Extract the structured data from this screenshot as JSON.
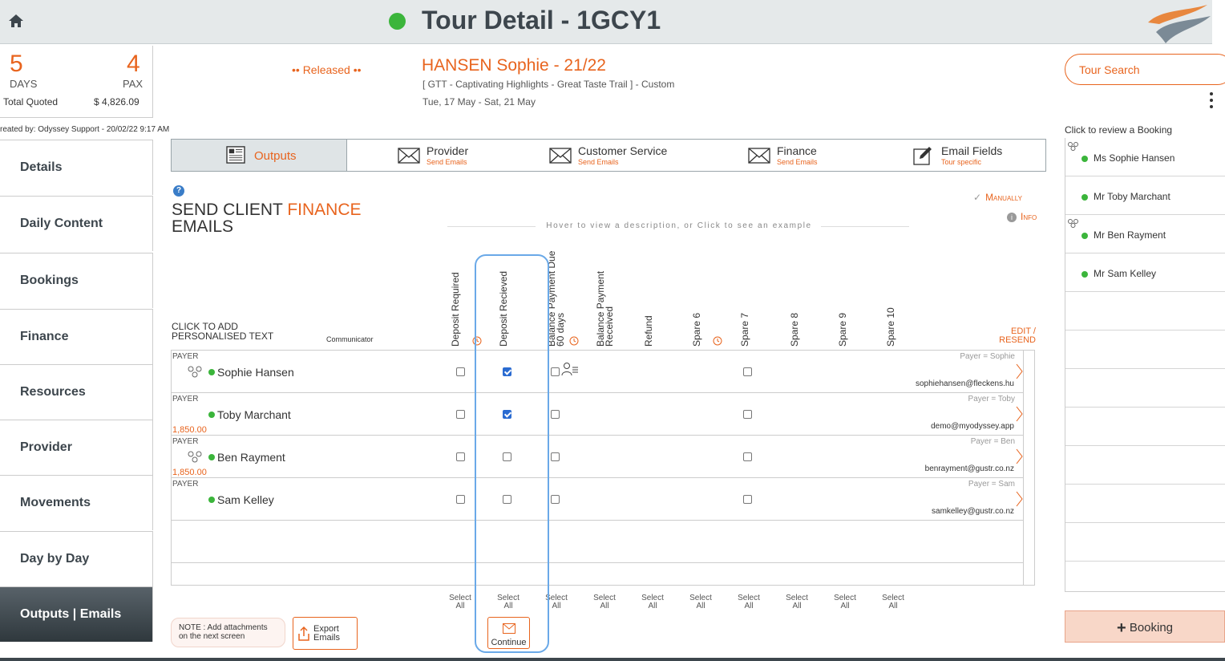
{
  "header": {
    "title": "Tour Detail - 1GCY1",
    "status_color": "#3bb53b"
  },
  "summary": {
    "days_value": "5",
    "days_label": "DAYS",
    "pax_value": "4",
    "pax_label": "PAX",
    "total_quoted_label": "Total Quoted",
    "total_quoted_value": "$ 4,826.09",
    "created_by": "reated by: Odyssey Support - 20/02/22 9:17 AM"
  },
  "tour": {
    "status": "•• Released ••",
    "client": "HANSEN Sophie - 21/22",
    "description": "[ GTT - Captivating Highlights - Great Taste Trail ] - Custom",
    "dates": "Tue, 17 May  - Sat, 21 May"
  },
  "right_panel": {
    "search_label": "Tour Search",
    "review_label": "Click to review a Booking",
    "bookings": [
      {
        "name": "Ms Sophie Hansen",
        "group_icon": true
      },
      {
        "name": "Mr Toby Marchant",
        "group_icon": false
      },
      {
        "name": "Mr Ben Rayment",
        "group_icon": true
      },
      {
        "name": "Mr Sam Kelley",
        "group_icon": false
      }
    ],
    "add_booking_label": "Booking"
  },
  "nav": {
    "items": [
      "Details",
      "Daily Content",
      "Bookings",
      "Finance",
      "Resources",
      "Provider",
      "Movements",
      "Day by Day",
      "Outputs | Emails"
    ],
    "active": "Outputs | Emails"
  },
  "tabs": [
    {
      "title": "Outputs",
      "sub": ""
    },
    {
      "title": "Provider",
      "sub": "Send Emails"
    },
    {
      "title": "Customer Service",
      "sub": "Send Emails"
    },
    {
      "title": "Finance",
      "sub": "Send Emails"
    },
    {
      "title": "Email Fields",
      "sub": "Tour specific"
    }
  ],
  "section": {
    "title_prefix": "SEND CLIENT ",
    "title_highlight": "FINANCE",
    "title_suffix": "EMAILS",
    "manually": "Manually",
    "info": "Info",
    "hover_hint": "Hover to view a description, or Click to see an example",
    "click_to_add": "CLICK TO ADD",
    "personalised_text": "PERSONALISED TEXT",
    "communicator": "Communicator",
    "edit_resend_1": "EDIT /",
    "edit_resend_2": "RESEND"
  },
  "columns": [
    "Deposit Required",
    "Deposit Recieved",
    "Balance Payment Due 60 days",
    "Balance Payment Received",
    "Refund",
    "Spare 6",
    "Spare 7",
    "Spare 8",
    "Spare 9",
    "Spare 10"
  ],
  "rows": [
    {
      "payer_label": "PAYER",
      "name": "Sophie Hansen",
      "group_icon": true,
      "amount": "",
      "payer_first": "Payer =  Sophie",
      "email": "sophiehansen@fleckens.hu",
      "checks": [
        false,
        true,
        false,
        false
      ],
      "person_icon": true
    },
    {
      "payer_label": "PAYER",
      "name": "Toby Marchant",
      "group_icon": false,
      "amount": "1,850.00",
      "payer_first": "Payer =  Toby",
      "email": "demo@myodyssey.app",
      "checks": [
        false,
        true,
        false,
        false
      ],
      "person_icon": false
    },
    {
      "payer_label": "PAYER",
      "name": "Ben Rayment",
      "group_icon": true,
      "amount": "1,850.00",
      "payer_first": "Payer =  Ben",
      "email": "benrayment@gustr.co.nz",
      "checks": [
        false,
        false,
        false,
        false
      ],
      "person_icon": false
    },
    {
      "payer_label": "PAYER",
      "name": "Sam Kelley",
      "group_icon": false,
      "amount": "",
      "payer_first": "Payer =  Sam",
      "email": "samkelley@gustr.co.nz",
      "checks": [
        false,
        false,
        false,
        false
      ],
      "person_icon": false
    }
  ],
  "select_all": {
    "line1": "Select",
    "line2": "All"
  },
  "footer": {
    "note_1": "NOTE : Add attachments",
    "note_2": "on the next screen",
    "export_1": "Export",
    "export_2": "Emails",
    "continue": "Continue"
  },
  "colors": {
    "accent": "#e8641e",
    "highlight": "#6aa9e8",
    "check": "#2a6bd1"
  }
}
